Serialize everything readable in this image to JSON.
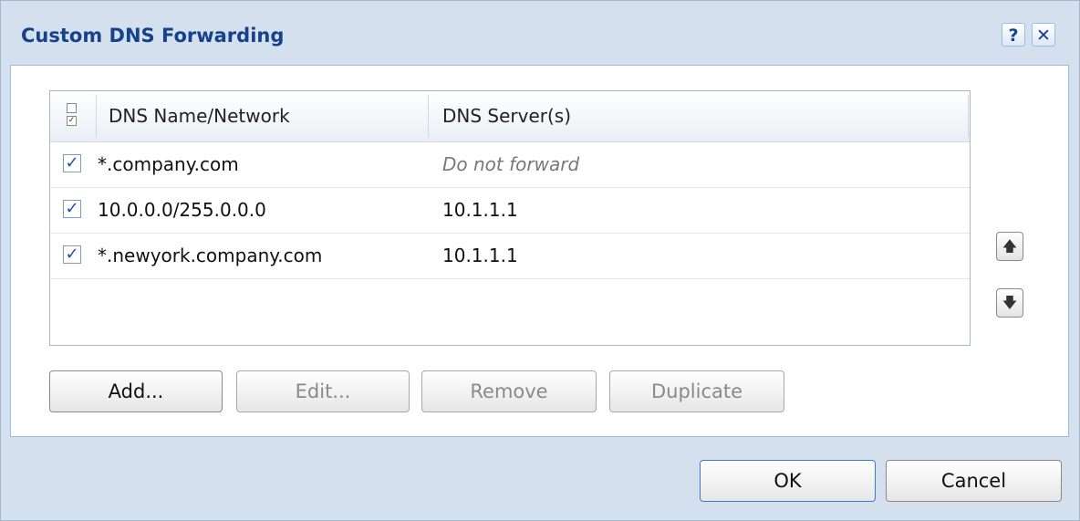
{
  "dialog": {
    "title": "Custom DNS Forwarding",
    "help_glyph": "?",
    "close_glyph": "✕"
  },
  "grid": {
    "columns": [
      "DNS Name/Network",
      "DNS Server(s)"
    ],
    "rows": [
      {
        "checked": true,
        "name": "*.company.com",
        "server": "Do not forward",
        "server_italic": true
      },
      {
        "checked": true,
        "name": "10.0.0.0/255.0.0.0",
        "server": "10.1.1.1",
        "server_italic": false
      },
      {
        "checked": true,
        "name": "*.newyork.company.com",
        "server": "10.1.1.1",
        "server_italic": false
      }
    ],
    "check_glyph": "✓"
  },
  "move_buttons": {
    "up_icon": "up-arrow-icon",
    "down_icon": "down-arrow-icon",
    "up_glyph": "🡅",
    "down_glyph": "🡇"
  },
  "actions": {
    "add": "Add...",
    "edit": "Edit...",
    "remove": "Remove",
    "duplicate": "Duplicate",
    "edit_enabled": false,
    "remove_enabled": false,
    "duplicate_enabled": false
  },
  "footer": {
    "ok": "OK",
    "cancel": "Cancel"
  },
  "colors": {
    "title": "#15428b",
    "frame": "#d4e0ee",
    "panel_border": "#99bbe8"
  }
}
